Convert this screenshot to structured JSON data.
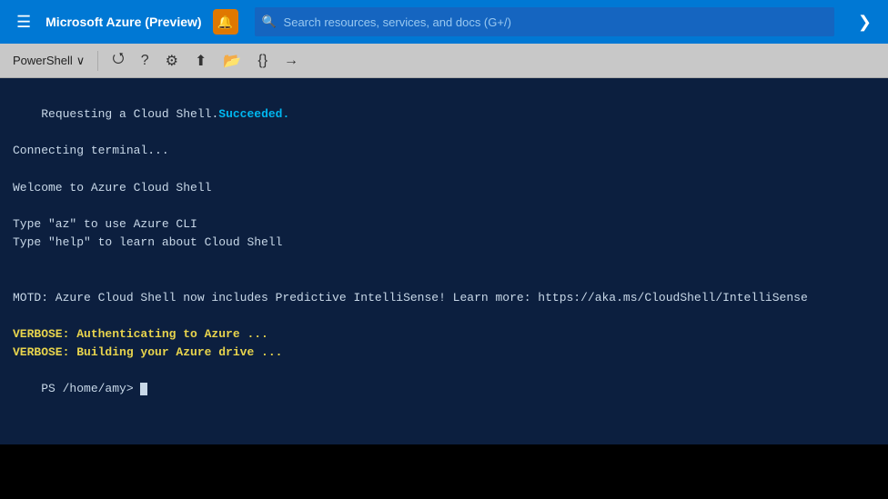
{
  "nav": {
    "hamburger_icon": "☰",
    "title": "Microsoft Azure (Preview)",
    "bell_icon": "🔔",
    "search_placeholder": "Search resources, services, and docs (G+/)",
    "arrow_icon": "❯"
  },
  "toolbar": {
    "shell_label": "PowerShell",
    "chevron_icon": "∨",
    "restart_icon": "⟳",
    "help_icon": "?",
    "settings_icon": "⚙",
    "upload_icon": "↑",
    "folder_icon": "📁",
    "braces_icon": "{}",
    "disconnect_icon": "↪"
  },
  "terminal": {
    "line1_prefix": "Requesting a Cloud Shell.",
    "line1_succeeded": "Succeeded.",
    "line2": "Connecting terminal...",
    "line3": "",
    "line4": "Welcome to Azure Cloud Shell",
    "line5": "",
    "line6": "Type \"az\" to use Azure CLI",
    "line7": "Type \"help\" to learn about Cloud Shell",
    "line8": "",
    "line9": "",
    "line10": "MOTD: Azure Cloud Shell now includes Predictive IntelliSense! Learn more: https://aka.ms/CloudShell/IntelliSense",
    "line11": "",
    "line12_verbose1": "VERBOSE: Authenticating to Azure ...",
    "line13_verbose2": "VERBOSE: Building your Azure drive ...",
    "line14_prompt": "PS /home/amy> "
  }
}
